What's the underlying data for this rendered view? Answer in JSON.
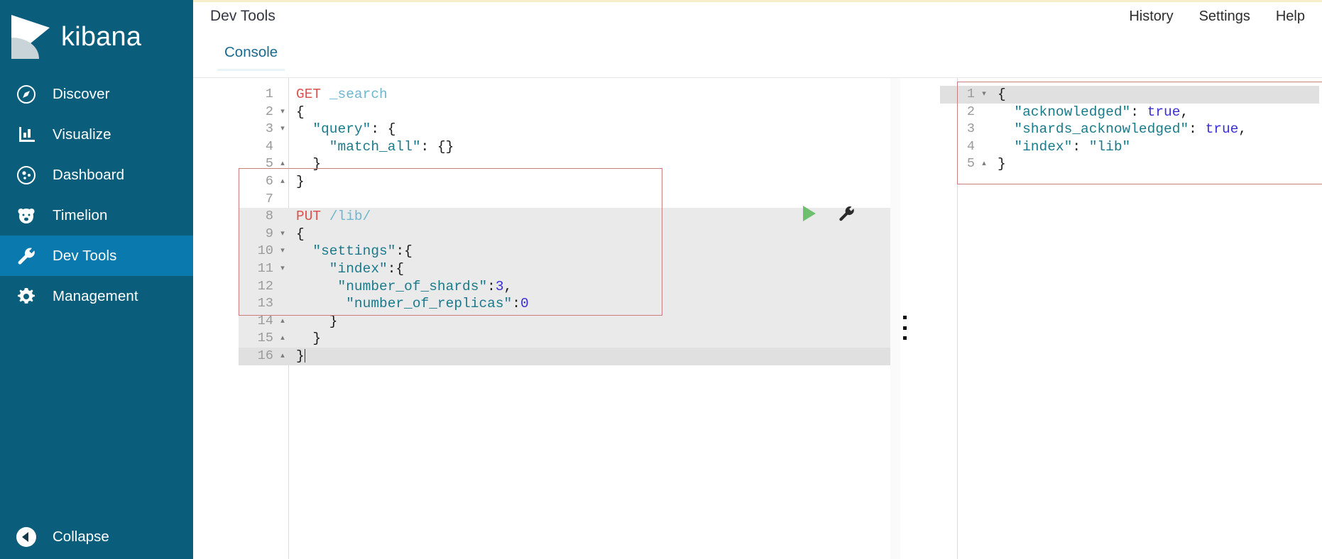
{
  "brand": {
    "name": "kibana",
    "logo_icon": "kibana-logo-icon"
  },
  "sidebar": {
    "items": [
      {
        "label": "Discover",
        "icon": "compass-icon",
        "active": false
      },
      {
        "label": "Visualize",
        "icon": "bar-chart-icon",
        "active": false
      },
      {
        "label": "Dashboard",
        "icon": "dashboard-icon",
        "active": false
      },
      {
        "label": "Timelion",
        "icon": "bear-face-icon",
        "active": false
      },
      {
        "label": "Dev Tools",
        "icon": "wrench-icon",
        "active": true
      },
      {
        "label": "Management",
        "icon": "gear-icon",
        "active": false
      }
    ],
    "collapse": {
      "label": "Collapse",
      "icon": "arrow-left-circle-icon"
    },
    "colors": {
      "background": "#0a5e7c",
      "active_background": "#0a79ad",
      "text": "#ffffff"
    }
  },
  "header": {
    "title": "Dev Tools",
    "links": [
      "History",
      "Settings",
      "Help"
    ]
  },
  "tabs": [
    {
      "label": "Console",
      "active": true
    }
  ],
  "editor": {
    "request_lines": [
      {
        "n": "1",
        "fold": "",
        "active": false,
        "in_request": false,
        "tokens": [
          {
            "t": "GET ",
            "c": "t-method"
          },
          {
            "t": "_search",
            "c": "t-url"
          }
        ]
      },
      {
        "n": "2",
        "fold": "▾",
        "active": false,
        "in_request": false,
        "tokens": [
          {
            "t": "{",
            "c": "t-punc"
          }
        ]
      },
      {
        "n": "3",
        "fold": "▾",
        "active": false,
        "in_request": false,
        "tokens": [
          {
            "t": "  \"query\"",
            "c": "t-key"
          },
          {
            "t": ": {",
            "c": "t-punc"
          }
        ]
      },
      {
        "n": "4",
        "fold": "",
        "active": false,
        "in_request": false,
        "tokens": [
          {
            "t": "    \"match_all\"",
            "c": "t-key"
          },
          {
            "t": ": {}",
            "c": "t-punc"
          }
        ]
      },
      {
        "n": "5",
        "fold": "▴",
        "active": false,
        "in_request": false,
        "tokens": [
          {
            "t": "  }",
            "c": "t-punc"
          }
        ]
      },
      {
        "n": "6",
        "fold": "▴",
        "active": false,
        "in_request": false,
        "tokens": [
          {
            "t": "}",
            "c": "t-punc"
          }
        ]
      },
      {
        "n": "7",
        "fold": "",
        "active": false,
        "in_request": false,
        "tokens": [
          {
            "t": "",
            "c": "t-punc"
          }
        ]
      },
      {
        "n": "8",
        "fold": "",
        "active": false,
        "in_request": true,
        "tokens": [
          {
            "t": "PUT ",
            "c": "t-method"
          },
          {
            "t": "/lib/",
            "c": "t-url"
          }
        ]
      },
      {
        "n": "9",
        "fold": "▾",
        "active": false,
        "in_request": true,
        "tokens": [
          {
            "t": "{",
            "c": "t-punc"
          }
        ]
      },
      {
        "n": "10",
        "fold": "▾",
        "active": false,
        "in_request": true,
        "tokens": [
          {
            "t": "  \"settings\"",
            "c": "t-key"
          },
          {
            "t": ":{",
            "c": "t-punc"
          }
        ]
      },
      {
        "n": "11",
        "fold": "▾",
        "active": false,
        "in_request": true,
        "tokens": [
          {
            "t": "    \"index\"",
            "c": "t-key"
          },
          {
            "t": ":{",
            "c": "t-punc"
          }
        ]
      },
      {
        "n": "12",
        "fold": "",
        "active": false,
        "in_request": true,
        "tokens": [
          {
            "t": "     \"number_of_shards\"",
            "c": "t-key"
          },
          {
            "t": ":",
            "c": "t-punc"
          },
          {
            "t": "3",
            "c": "t-num"
          },
          {
            "t": ",",
            "c": "t-punc"
          }
        ]
      },
      {
        "n": "13",
        "fold": "",
        "active": false,
        "in_request": true,
        "tokens": [
          {
            "t": "      \"number_of_replicas\"",
            "c": "t-key"
          },
          {
            "t": ":",
            "c": "t-punc"
          },
          {
            "t": "0",
            "c": "t-num"
          }
        ]
      },
      {
        "n": "14",
        "fold": "▴",
        "active": false,
        "in_request": true,
        "tokens": [
          {
            "t": "    }",
            "c": "t-punc"
          }
        ]
      },
      {
        "n": "15",
        "fold": "▴",
        "active": false,
        "in_request": true,
        "tokens": [
          {
            "t": "  }",
            "c": "t-punc"
          }
        ]
      },
      {
        "n": "16",
        "fold": "▴",
        "active": true,
        "in_request": true,
        "tokens": [
          {
            "t": "}",
            "c": "t-punc"
          }
        ],
        "cursor": true
      }
    ],
    "actions": {
      "play": {
        "icon": "play-icon",
        "color": "#6ec06e",
        "title": "Click to send request"
      },
      "wrench": {
        "icon": "wrench-icon",
        "color": "#2b2b2b",
        "title": "Open documentation"
      }
    },
    "drag_handle": {
      "icon": "drag-handle-icon"
    }
  },
  "response": {
    "lines": [
      {
        "n": "1",
        "fold": "▾",
        "active": true,
        "tokens": [
          {
            "t": "{",
            "c": "t-punc"
          }
        ]
      },
      {
        "n": "2",
        "fold": "",
        "active": false,
        "tokens": [
          {
            "t": "  \"acknowledged\"",
            "c": "t-key"
          },
          {
            "t": ": ",
            "c": "t-punc"
          },
          {
            "t": "true",
            "c": "t-bool"
          },
          {
            "t": ",",
            "c": "t-punc"
          }
        ]
      },
      {
        "n": "3",
        "fold": "",
        "active": false,
        "tokens": [
          {
            "t": "  \"shards_acknowledged\"",
            "c": "t-key"
          },
          {
            "t": ": ",
            "c": "t-punc"
          },
          {
            "t": "true",
            "c": "t-bool"
          },
          {
            "t": ",",
            "c": "t-punc"
          }
        ]
      },
      {
        "n": "4",
        "fold": "",
        "active": false,
        "tokens": [
          {
            "t": "  \"index\"",
            "c": "t-key"
          },
          {
            "t": ": ",
            "c": "t-punc"
          },
          {
            "t": "\"lib\"",
            "c": "t-str"
          }
        ]
      },
      {
        "n": "5",
        "fold": "▴",
        "active": false,
        "tokens": [
          {
            "t": "}",
            "c": "t-punc"
          }
        ]
      }
    ]
  },
  "colors": {
    "request_outline": "#cc7d7d",
    "request_background": "#eaeaea",
    "active_line": "#e0e0e0",
    "accent_top_strip": "#f5eec8"
  }
}
